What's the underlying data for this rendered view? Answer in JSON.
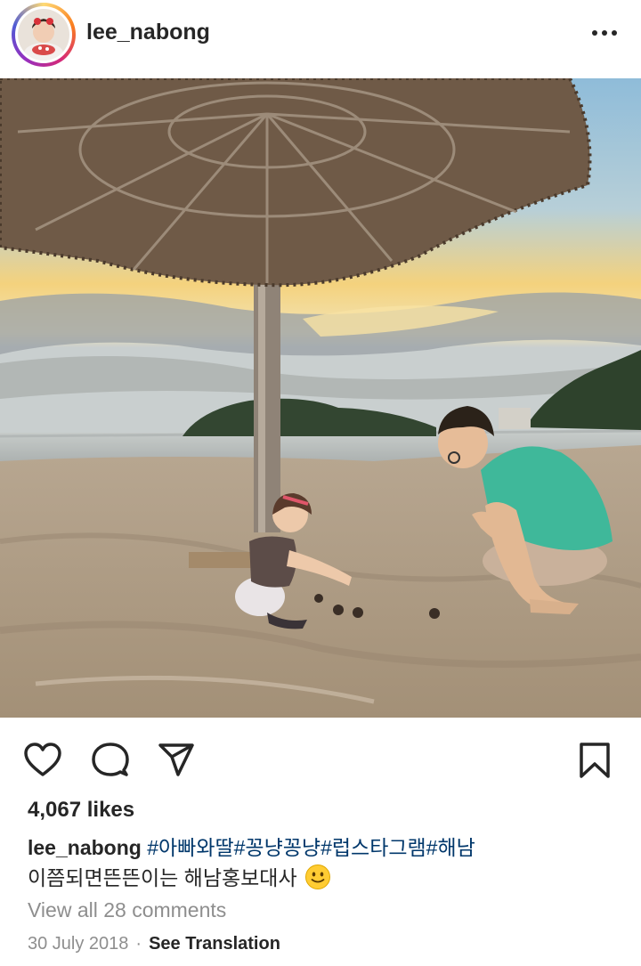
{
  "post": {
    "username": "lee_nabong",
    "likes": "4,067 likes",
    "caption": {
      "username": "lee_nabong",
      "hashtags": [
        "#아빠와딸",
        "#꽁냥꽁냥",
        "#럽스타그램",
        "#해남"
      ],
      "text": "이쯤되면뜬뜬이는 해남홍보대사",
      "emoji": "slightly-smiling-face-emoji"
    },
    "comments_link": "View all 28 comments",
    "date": "30 July 2018",
    "separator": "·",
    "translation_link": "See Translation"
  },
  "icons": {
    "more": "more-options-icon",
    "like": "heart-icon",
    "comment": "comment-bubble-icon",
    "share": "paper-plane-icon",
    "save": "bookmark-icon"
  },
  "colors": {
    "text": "#262626",
    "hashtag": "#00376b",
    "secondary": "#8e8e8e",
    "sky": "#9fc6dc",
    "sunset": "#f6cf74",
    "sand": "#bfae97",
    "shirt": "#3fb89a"
  }
}
